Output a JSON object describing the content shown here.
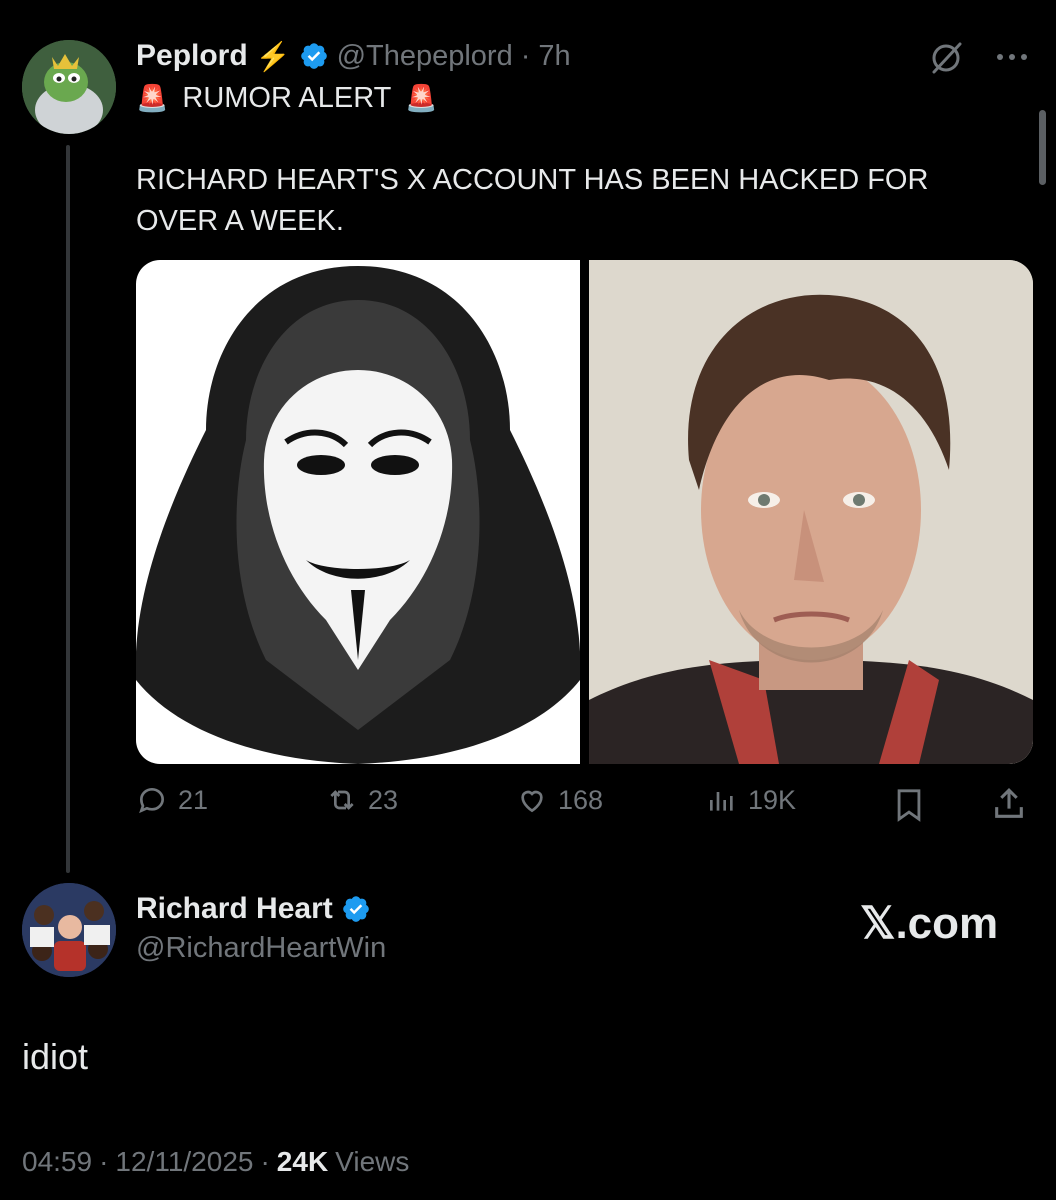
{
  "parent_tweet": {
    "author_name": "Peplord",
    "author_emoji": "⚡",
    "handle": "@Thepeplord",
    "separator": "·",
    "time": "7h",
    "alert_emoji": "🚨",
    "alert_text": "RUMOR ALERT",
    "body": "RICHARD HEART'S X ACCOUNT HAS BEEN HACKED FOR OVER A WEEK.",
    "actions": {
      "replies": "21",
      "reposts": "23",
      "likes": "168",
      "views": "19K"
    }
  },
  "reply_tweet": {
    "author_name": "Richard Heart",
    "handle": "@RichardHeartWin",
    "body": "idiot",
    "meta_time": "04:59",
    "meta_sep1": "·",
    "meta_date": "12/11/2025",
    "meta_sep2": "·",
    "views_count": "24K",
    "views_label": "Views"
  },
  "watermark": "𝕏.com",
  "colors": {
    "background": "#000000",
    "text": "#e7e9ea",
    "muted": "#71767b",
    "verified_blue": "#1d9bf0",
    "lightning": "#f4b400"
  },
  "icons": [
    "grok-icon",
    "more-icon",
    "reply-icon",
    "repost-icon",
    "like-icon",
    "views-icon",
    "bookmark-icon",
    "share-icon",
    "verified-badge-icon"
  ]
}
